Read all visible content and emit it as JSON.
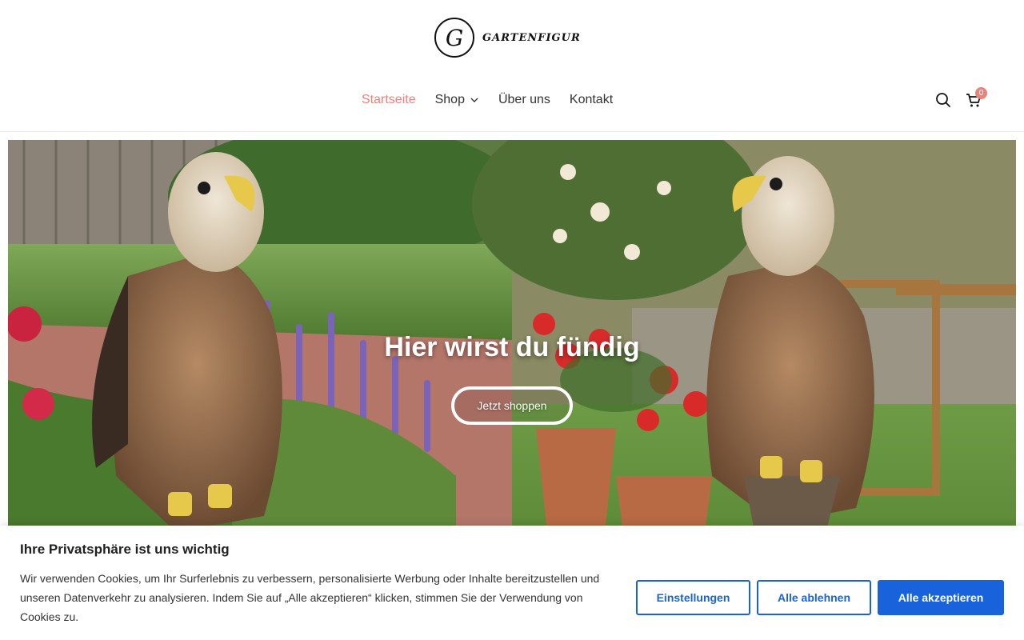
{
  "brand": {
    "logo_letter": "G",
    "logo_text": "GARTENFIGUR"
  },
  "nav": {
    "items": [
      {
        "label": "Startseite",
        "active": true
      },
      {
        "label": "Shop",
        "has_dropdown": true
      },
      {
        "label": "Über uns"
      },
      {
        "label": "Kontakt"
      }
    ]
  },
  "header_icons": {
    "search": "search-icon",
    "cart": "cart-icon",
    "cart_count": "0"
  },
  "hero": {
    "title": "Hier wirst du fündig",
    "button_label": "Jetzt shoppen"
  },
  "cookie": {
    "title": "Ihre Privatsphäre ist uns wichtig",
    "text": "Wir verwenden Cookies, um Ihr Surferlebnis zu verbessern, personalisierte Werbung oder Inhalte bereitzustellen und unseren Datenverkehr zu analysieren. Indem Sie auf „Alle akzeptieren“ klicken, stimmen Sie der Verwendung von Cookies zu.",
    "btn_settings": "Einstellungen",
    "btn_reject": "Alle ablehnen",
    "btn_accept": "Alle akzeptieren"
  },
  "colors": {
    "accent": "#e8837a",
    "primary": "#1863dc"
  }
}
